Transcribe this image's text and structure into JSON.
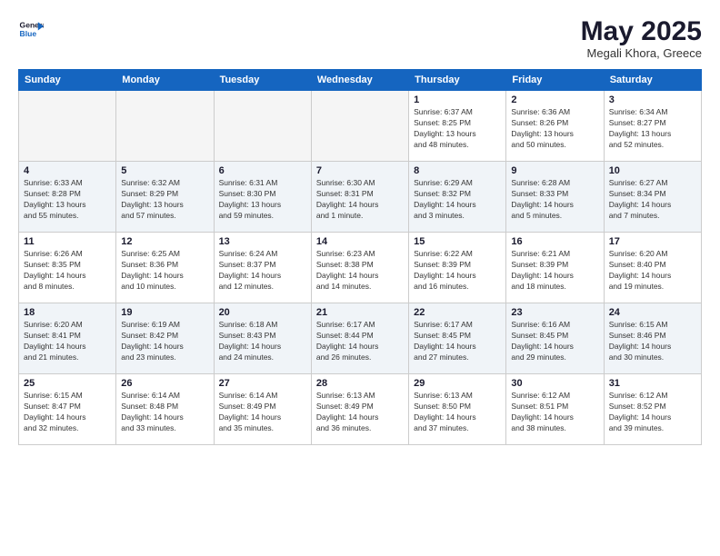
{
  "header": {
    "logo_line1": "General",
    "logo_line2": "Blue",
    "title": "May 2025",
    "subtitle": "Megali Khora, Greece"
  },
  "weekdays": [
    "Sunday",
    "Monday",
    "Tuesday",
    "Wednesday",
    "Thursday",
    "Friday",
    "Saturday"
  ],
  "weeks": [
    [
      {
        "day": "",
        "info": ""
      },
      {
        "day": "",
        "info": ""
      },
      {
        "day": "",
        "info": ""
      },
      {
        "day": "",
        "info": ""
      },
      {
        "day": "1",
        "info": "Sunrise: 6:37 AM\nSunset: 8:25 PM\nDaylight: 13 hours\nand 48 minutes."
      },
      {
        "day": "2",
        "info": "Sunrise: 6:36 AM\nSunset: 8:26 PM\nDaylight: 13 hours\nand 50 minutes."
      },
      {
        "day": "3",
        "info": "Sunrise: 6:34 AM\nSunset: 8:27 PM\nDaylight: 13 hours\nand 52 minutes."
      }
    ],
    [
      {
        "day": "4",
        "info": "Sunrise: 6:33 AM\nSunset: 8:28 PM\nDaylight: 13 hours\nand 55 minutes."
      },
      {
        "day": "5",
        "info": "Sunrise: 6:32 AM\nSunset: 8:29 PM\nDaylight: 13 hours\nand 57 minutes."
      },
      {
        "day": "6",
        "info": "Sunrise: 6:31 AM\nSunset: 8:30 PM\nDaylight: 13 hours\nand 59 minutes."
      },
      {
        "day": "7",
        "info": "Sunrise: 6:30 AM\nSunset: 8:31 PM\nDaylight: 14 hours\nand 1 minute."
      },
      {
        "day": "8",
        "info": "Sunrise: 6:29 AM\nSunset: 8:32 PM\nDaylight: 14 hours\nand 3 minutes."
      },
      {
        "day": "9",
        "info": "Sunrise: 6:28 AM\nSunset: 8:33 PM\nDaylight: 14 hours\nand 5 minutes."
      },
      {
        "day": "10",
        "info": "Sunrise: 6:27 AM\nSunset: 8:34 PM\nDaylight: 14 hours\nand 7 minutes."
      }
    ],
    [
      {
        "day": "11",
        "info": "Sunrise: 6:26 AM\nSunset: 8:35 PM\nDaylight: 14 hours\nand 8 minutes."
      },
      {
        "day": "12",
        "info": "Sunrise: 6:25 AM\nSunset: 8:36 PM\nDaylight: 14 hours\nand 10 minutes."
      },
      {
        "day": "13",
        "info": "Sunrise: 6:24 AM\nSunset: 8:37 PM\nDaylight: 14 hours\nand 12 minutes."
      },
      {
        "day": "14",
        "info": "Sunrise: 6:23 AM\nSunset: 8:38 PM\nDaylight: 14 hours\nand 14 minutes."
      },
      {
        "day": "15",
        "info": "Sunrise: 6:22 AM\nSunset: 8:39 PM\nDaylight: 14 hours\nand 16 minutes."
      },
      {
        "day": "16",
        "info": "Sunrise: 6:21 AM\nSunset: 8:39 PM\nDaylight: 14 hours\nand 18 minutes."
      },
      {
        "day": "17",
        "info": "Sunrise: 6:20 AM\nSunset: 8:40 PM\nDaylight: 14 hours\nand 19 minutes."
      }
    ],
    [
      {
        "day": "18",
        "info": "Sunrise: 6:20 AM\nSunset: 8:41 PM\nDaylight: 14 hours\nand 21 minutes."
      },
      {
        "day": "19",
        "info": "Sunrise: 6:19 AM\nSunset: 8:42 PM\nDaylight: 14 hours\nand 23 minutes."
      },
      {
        "day": "20",
        "info": "Sunrise: 6:18 AM\nSunset: 8:43 PM\nDaylight: 14 hours\nand 24 minutes."
      },
      {
        "day": "21",
        "info": "Sunrise: 6:17 AM\nSunset: 8:44 PM\nDaylight: 14 hours\nand 26 minutes."
      },
      {
        "day": "22",
        "info": "Sunrise: 6:17 AM\nSunset: 8:45 PM\nDaylight: 14 hours\nand 27 minutes."
      },
      {
        "day": "23",
        "info": "Sunrise: 6:16 AM\nSunset: 8:45 PM\nDaylight: 14 hours\nand 29 minutes."
      },
      {
        "day": "24",
        "info": "Sunrise: 6:15 AM\nSunset: 8:46 PM\nDaylight: 14 hours\nand 30 minutes."
      }
    ],
    [
      {
        "day": "25",
        "info": "Sunrise: 6:15 AM\nSunset: 8:47 PM\nDaylight: 14 hours\nand 32 minutes."
      },
      {
        "day": "26",
        "info": "Sunrise: 6:14 AM\nSunset: 8:48 PM\nDaylight: 14 hours\nand 33 minutes."
      },
      {
        "day": "27",
        "info": "Sunrise: 6:14 AM\nSunset: 8:49 PM\nDaylight: 14 hours\nand 35 minutes."
      },
      {
        "day": "28",
        "info": "Sunrise: 6:13 AM\nSunset: 8:49 PM\nDaylight: 14 hours\nand 36 minutes."
      },
      {
        "day": "29",
        "info": "Sunrise: 6:13 AM\nSunset: 8:50 PM\nDaylight: 14 hours\nand 37 minutes."
      },
      {
        "day": "30",
        "info": "Sunrise: 6:12 AM\nSunset: 8:51 PM\nDaylight: 14 hours\nand 38 minutes."
      },
      {
        "day": "31",
        "info": "Sunrise: 6:12 AM\nSunset: 8:52 PM\nDaylight: 14 hours\nand 39 minutes."
      }
    ]
  ]
}
